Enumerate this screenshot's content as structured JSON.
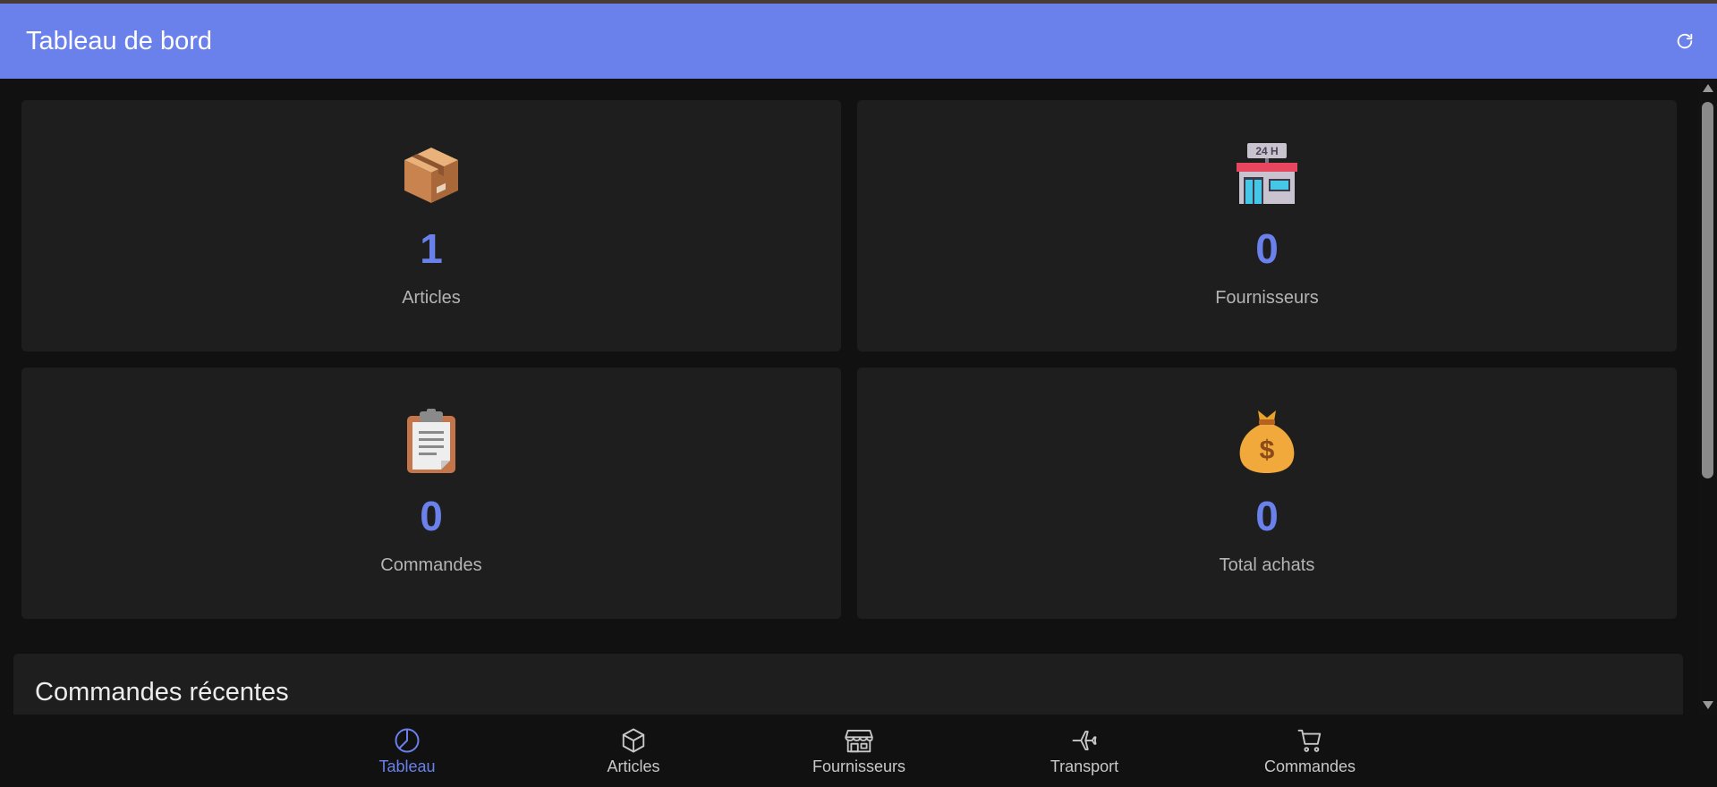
{
  "header": {
    "title": "Tableau de bord",
    "refresh_icon": "refresh-icon"
  },
  "stats": [
    {
      "icon": "package-icon",
      "value": "1",
      "label": "Articles"
    },
    {
      "icon": "store-24h-icon",
      "value": "0",
      "label": "Fournisseurs"
    },
    {
      "icon": "clipboard-icon",
      "value": "0",
      "label": "Commandes"
    },
    {
      "icon": "money-bag-icon",
      "value": "0",
      "label": "Total achats"
    }
  ],
  "recent": {
    "title": "Commandes récentes"
  },
  "store_sign": "24 H",
  "nav": {
    "active": "Tableau",
    "items": [
      {
        "label": "Tableau",
        "icon": "pie-chart-icon"
      },
      {
        "label": "Articles",
        "icon": "box-icon"
      },
      {
        "label": "Fournisseurs",
        "icon": "shop-icon"
      },
      {
        "label": "Transport",
        "icon": "airplane-icon"
      },
      {
        "label": "Commandes",
        "icon": "cart-icon"
      }
    ]
  },
  "colors": {
    "accent": "#6a80ea",
    "background": "#111111",
    "card": "#1e1e1e"
  }
}
